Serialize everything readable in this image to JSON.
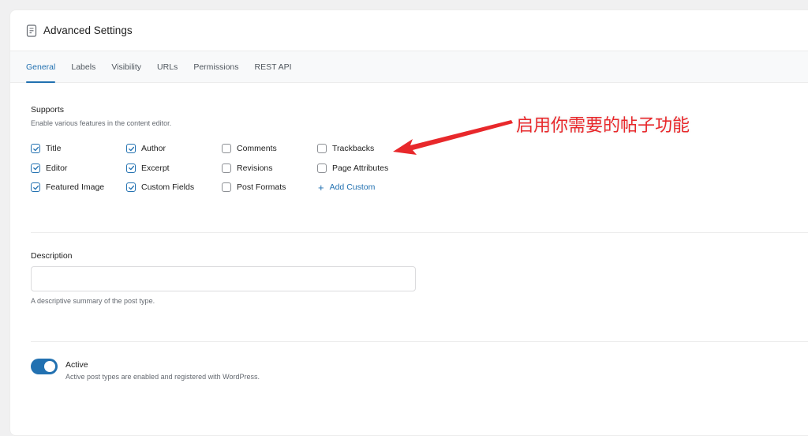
{
  "header": {
    "icon": "document-icon",
    "title": "Advanced Settings"
  },
  "tabs": [
    {
      "label": "General",
      "active": true
    },
    {
      "label": "Labels",
      "active": false
    },
    {
      "label": "Visibility",
      "active": false
    },
    {
      "label": "URLs",
      "active": false
    },
    {
      "label": "Permissions",
      "active": false
    },
    {
      "label": "REST API",
      "active": false
    }
  ],
  "supports": {
    "label": "Supports",
    "help": "Enable various features in the content editor.",
    "items": [
      {
        "label": "Title",
        "checked": true
      },
      {
        "label": "Author",
        "checked": true
      },
      {
        "label": "Comments",
        "checked": false
      },
      {
        "label": "Trackbacks",
        "checked": false
      },
      {
        "label": "Editor",
        "checked": true
      },
      {
        "label": "Excerpt",
        "checked": true
      },
      {
        "label": "Revisions",
        "checked": false
      },
      {
        "label": "Page Attributes",
        "checked": false
      },
      {
        "label": "Featured Image",
        "checked": true
      },
      {
        "label": "Custom Fields",
        "checked": true
      },
      {
        "label": "Post Formats",
        "checked": false
      }
    ],
    "add_custom_label": "Add Custom"
  },
  "description": {
    "label": "Description",
    "value": "",
    "placeholder": "",
    "help": "A descriptive summary of the post type."
  },
  "active": {
    "label": "Active",
    "enabled": true,
    "help": "Active post types are enabled and registered with WordPress."
  },
  "annotation": {
    "text": "启用你需要的帖子功能",
    "color": "#e8282b"
  },
  "colors": {
    "accent": "#2271b1",
    "annotation": "#e8282b"
  }
}
